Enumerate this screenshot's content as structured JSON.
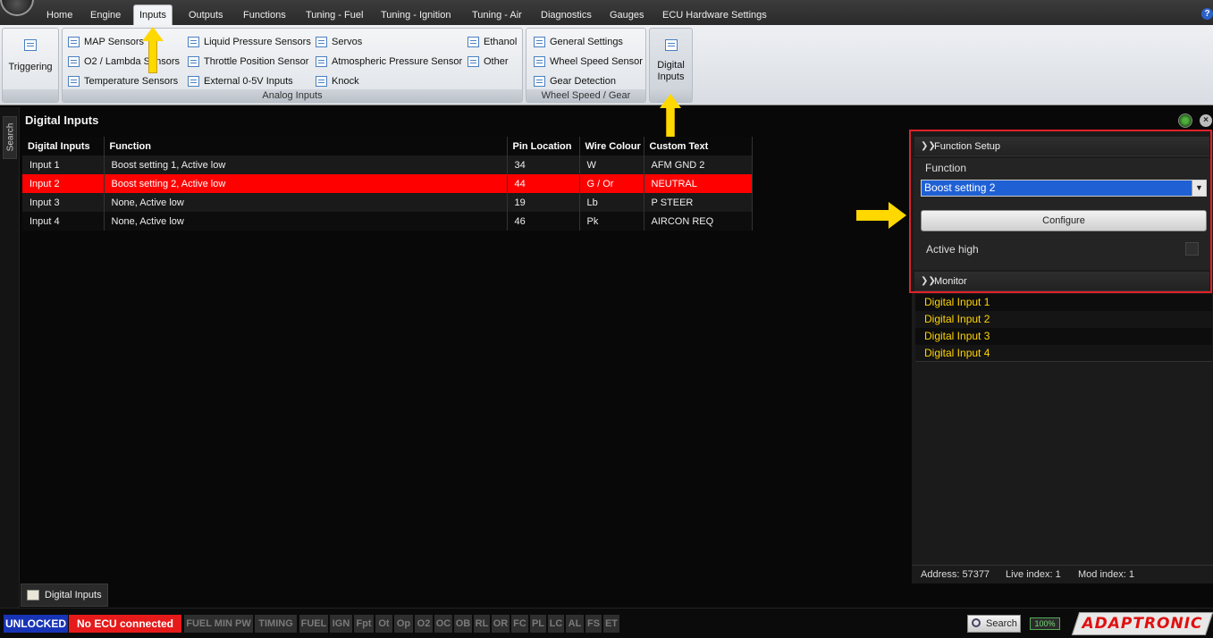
{
  "menubar": {
    "items": [
      "Home",
      "Engine",
      "Inputs",
      "Outputs",
      "Functions",
      "Tuning - Fuel",
      "Tuning - Ignition",
      "Tuning - Air",
      "Diagnostics",
      "Gauges",
      "ECU Hardware Settings"
    ],
    "active": "Inputs",
    "help_icon": "?"
  },
  "ribbon": {
    "triggering": "Triggering",
    "analog": {
      "col1": [
        "MAP Sensors",
        "O2 / Lambda Sensors",
        "Temperature Sensors"
      ],
      "col2": [
        "Liquid Pressure Sensors",
        "Throttle Position Sensor",
        "External 0-5V Inputs"
      ],
      "col3": [
        "Servos",
        "Atmospheric Pressure Sensor",
        "Knock"
      ],
      "col4": [
        "Ethanol",
        "Other"
      ],
      "title": "Analog Inputs"
    },
    "wheel": {
      "items": [
        "General Settings",
        "Wheel Speed Sensor",
        "Gear Detection"
      ],
      "title": "Wheel Speed / Gear"
    },
    "digital_inputs": [
      "Digital",
      "Inputs"
    ]
  },
  "side": {
    "search_tab": "Search"
  },
  "panel": {
    "title": "Digital Inputs",
    "columns": [
      "Digital Inputs",
      "Function",
      "Pin Location",
      "Wire Colour",
      "Custom Text"
    ],
    "rows": [
      [
        "Input 1",
        "Boost setting 1, Active low",
        "34",
        "W",
        "AFM GND 2"
      ],
      [
        "Input 2",
        "Boost setting 2, Active low",
        "44",
        "G / Or",
        "NEUTRAL"
      ],
      [
        "Input 3",
        "None, Active low",
        "19",
        "Lb",
        "P STEER"
      ],
      [
        "Input 4",
        "None, Active low",
        "46",
        "Pk",
        "AIRCON REQ"
      ]
    ],
    "selected_row": 1
  },
  "doc_tab": {
    "label": "Digital Inputs"
  },
  "right": {
    "function_setup": {
      "header": "Function Setup",
      "function_label": "Function",
      "function_value": "Boost setting 2",
      "configure": "Configure",
      "active_high": "Active high",
      "active_high_checked": false
    },
    "monitor": {
      "header": "Monitor",
      "items": [
        "Digital Input 1",
        "Digital Input 2",
        "Digital Input 3",
        "Digital Input 4"
      ]
    },
    "footer": {
      "address": "Address: 57377",
      "live_index": "Live index: 1",
      "mod_index": "Mod index: 1"
    }
  },
  "statusbar": {
    "unlocked": "UNLOCKED",
    "no_ecu": "No ECU connected",
    "flags": [
      "FUEL MIN PW",
      "TIMING",
      "FUEL",
      "IGN",
      "Fpt",
      "Ot",
      "Op",
      "O2",
      "OC",
      "OB",
      "RL",
      "OR",
      "FC",
      "PL",
      "LC",
      "AL",
      "FS",
      "ET"
    ],
    "search": "Search",
    "battery": "100%",
    "logo": "ADAPTRONIC"
  },
  "colors": {
    "selected_row": "#ff0000",
    "highlight_border": "#e0222a",
    "monitor_text": "#ffd400",
    "arrow": "#ffd800",
    "unlocked_bg": "#1834b6",
    "no_ecu_bg": "#e61a1a"
  },
  "icons": {
    "logo": "app-logo-icon",
    "help": "help-icon",
    "ribbon_item": "list-icon",
    "gauge": "gauge-icon",
    "close": "close-icon",
    "chevron": "chevron-down-icon",
    "search": "search-icon",
    "battery": "battery-icon"
  }
}
